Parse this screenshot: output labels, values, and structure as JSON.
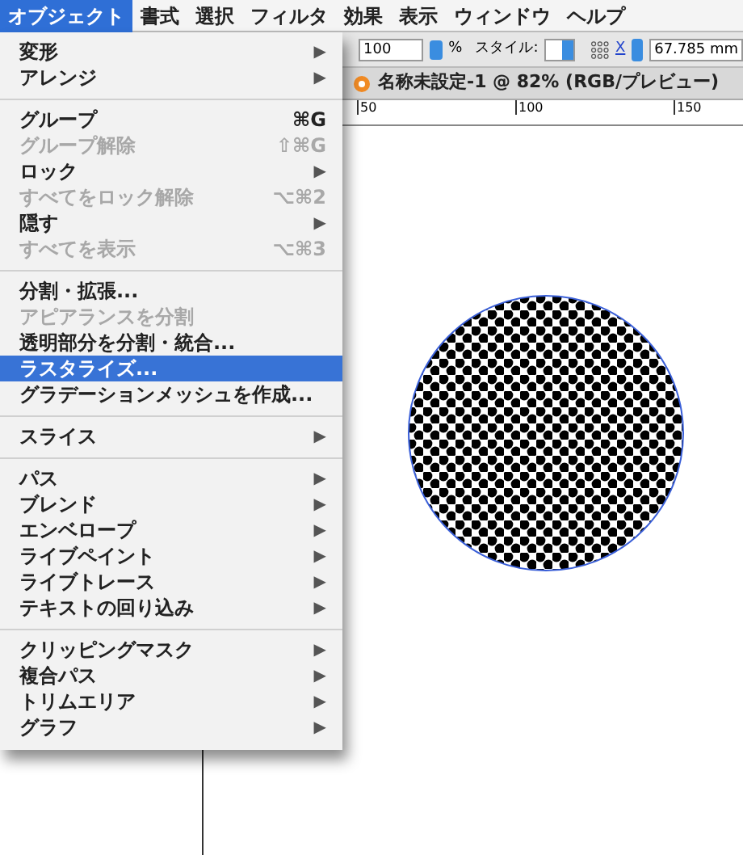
{
  "menu_bar": [
    {
      "label": "オブジェクト",
      "selected": true
    },
    {
      "label": "書式",
      "selected": false
    },
    {
      "label": "選択",
      "selected": false
    },
    {
      "label": "フィルタ",
      "selected": false
    },
    {
      "label": "効果",
      "selected": false
    },
    {
      "label": "表示",
      "selected": false
    },
    {
      "label": "ウィンドウ",
      "selected": false
    },
    {
      "label": "ヘルプ",
      "selected": false
    }
  ],
  "menu": [
    {
      "kind": "item",
      "label": "変形",
      "submenu": "▶",
      "disabled": false,
      "selected": false
    },
    {
      "kind": "item",
      "label": "アレンジ",
      "submenu": "▶",
      "disabled": false,
      "selected": false
    },
    {
      "kind": "separator"
    },
    {
      "kind": "item",
      "label": "グループ",
      "shortcut": "⌘G",
      "disabled": false,
      "selected": false
    },
    {
      "kind": "item",
      "label": "グループ解除",
      "shortcut": "⇧⌘G",
      "disabled": true,
      "selected": false
    },
    {
      "kind": "item",
      "label": "ロック",
      "submenu": "▶",
      "disabled": false,
      "selected": false
    },
    {
      "kind": "item",
      "label": "すべてをロック解除",
      "shortcut": "⌥⌘2",
      "disabled": true,
      "selected": false
    },
    {
      "kind": "item",
      "label": "隠す",
      "submenu": "▶",
      "disabled": false,
      "selected": false
    },
    {
      "kind": "item",
      "label": "すべてを表示",
      "shortcut": "⌥⌘3",
      "disabled": true,
      "selected": false
    },
    {
      "kind": "separator"
    },
    {
      "kind": "item",
      "label": "分割・拡張...",
      "disabled": false,
      "selected": false
    },
    {
      "kind": "item",
      "label": "アピアランスを分割",
      "disabled": true,
      "selected": false
    },
    {
      "kind": "item",
      "label": "透明部分を分割・統合...",
      "disabled": false,
      "selected": false
    },
    {
      "kind": "item",
      "label": "ラスタライズ...",
      "disabled": false,
      "selected": true
    },
    {
      "kind": "item",
      "label": "グラデーションメッシュを作成...",
      "disabled": false,
      "selected": false
    },
    {
      "kind": "separator"
    },
    {
      "kind": "item",
      "label": "スライス",
      "submenu": "▶",
      "disabled": false,
      "selected": false
    },
    {
      "kind": "separator"
    },
    {
      "kind": "item",
      "label": "パス",
      "submenu": "▶",
      "disabled": false,
      "selected": false
    },
    {
      "kind": "item",
      "label": "ブレンド",
      "submenu": "▶",
      "disabled": false,
      "selected": false
    },
    {
      "kind": "item",
      "label": "エンベロープ",
      "submenu": "▶",
      "disabled": false,
      "selected": false
    },
    {
      "kind": "item",
      "label": "ライブペイント",
      "submenu": "▶",
      "disabled": false,
      "selected": false
    },
    {
      "kind": "item",
      "label": "ライブトレース",
      "submenu": "▶",
      "disabled": false,
      "selected": false
    },
    {
      "kind": "item",
      "label": "テキストの回り込み",
      "submenu": "▶",
      "disabled": false,
      "selected": false
    },
    {
      "kind": "separator"
    },
    {
      "kind": "item",
      "label": "クリッピングマスク",
      "submenu": "▶",
      "disabled": false,
      "selected": false
    },
    {
      "kind": "item",
      "label": "複合パス",
      "submenu": "▶",
      "disabled": false,
      "selected": false
    },
    {
      "kind": "item",
      "label": "トリムエリア",
      "submenu": "▶",
      "disabled": false,
      "selected": false
    },
    {
      "kind": "item",
      "label": "グラフ",
      "submenu": "▶",
      "disabled": false,
      "selected": false
    }
  ],
  "toolbar": {
    "opacity": "100",
    "percent": "%",
    "style_label": "スタイル:",
    "x_label": "X",
    "x_value": "67.785 mm"
  },
  "document_tab": {
    "title": "名称未設定-1 @ 82% (RGB/プレビュー)"
  },
  "ruler": {
    "ticks": [
      "50",
      "100",
      "150"
    ]
  }
}
